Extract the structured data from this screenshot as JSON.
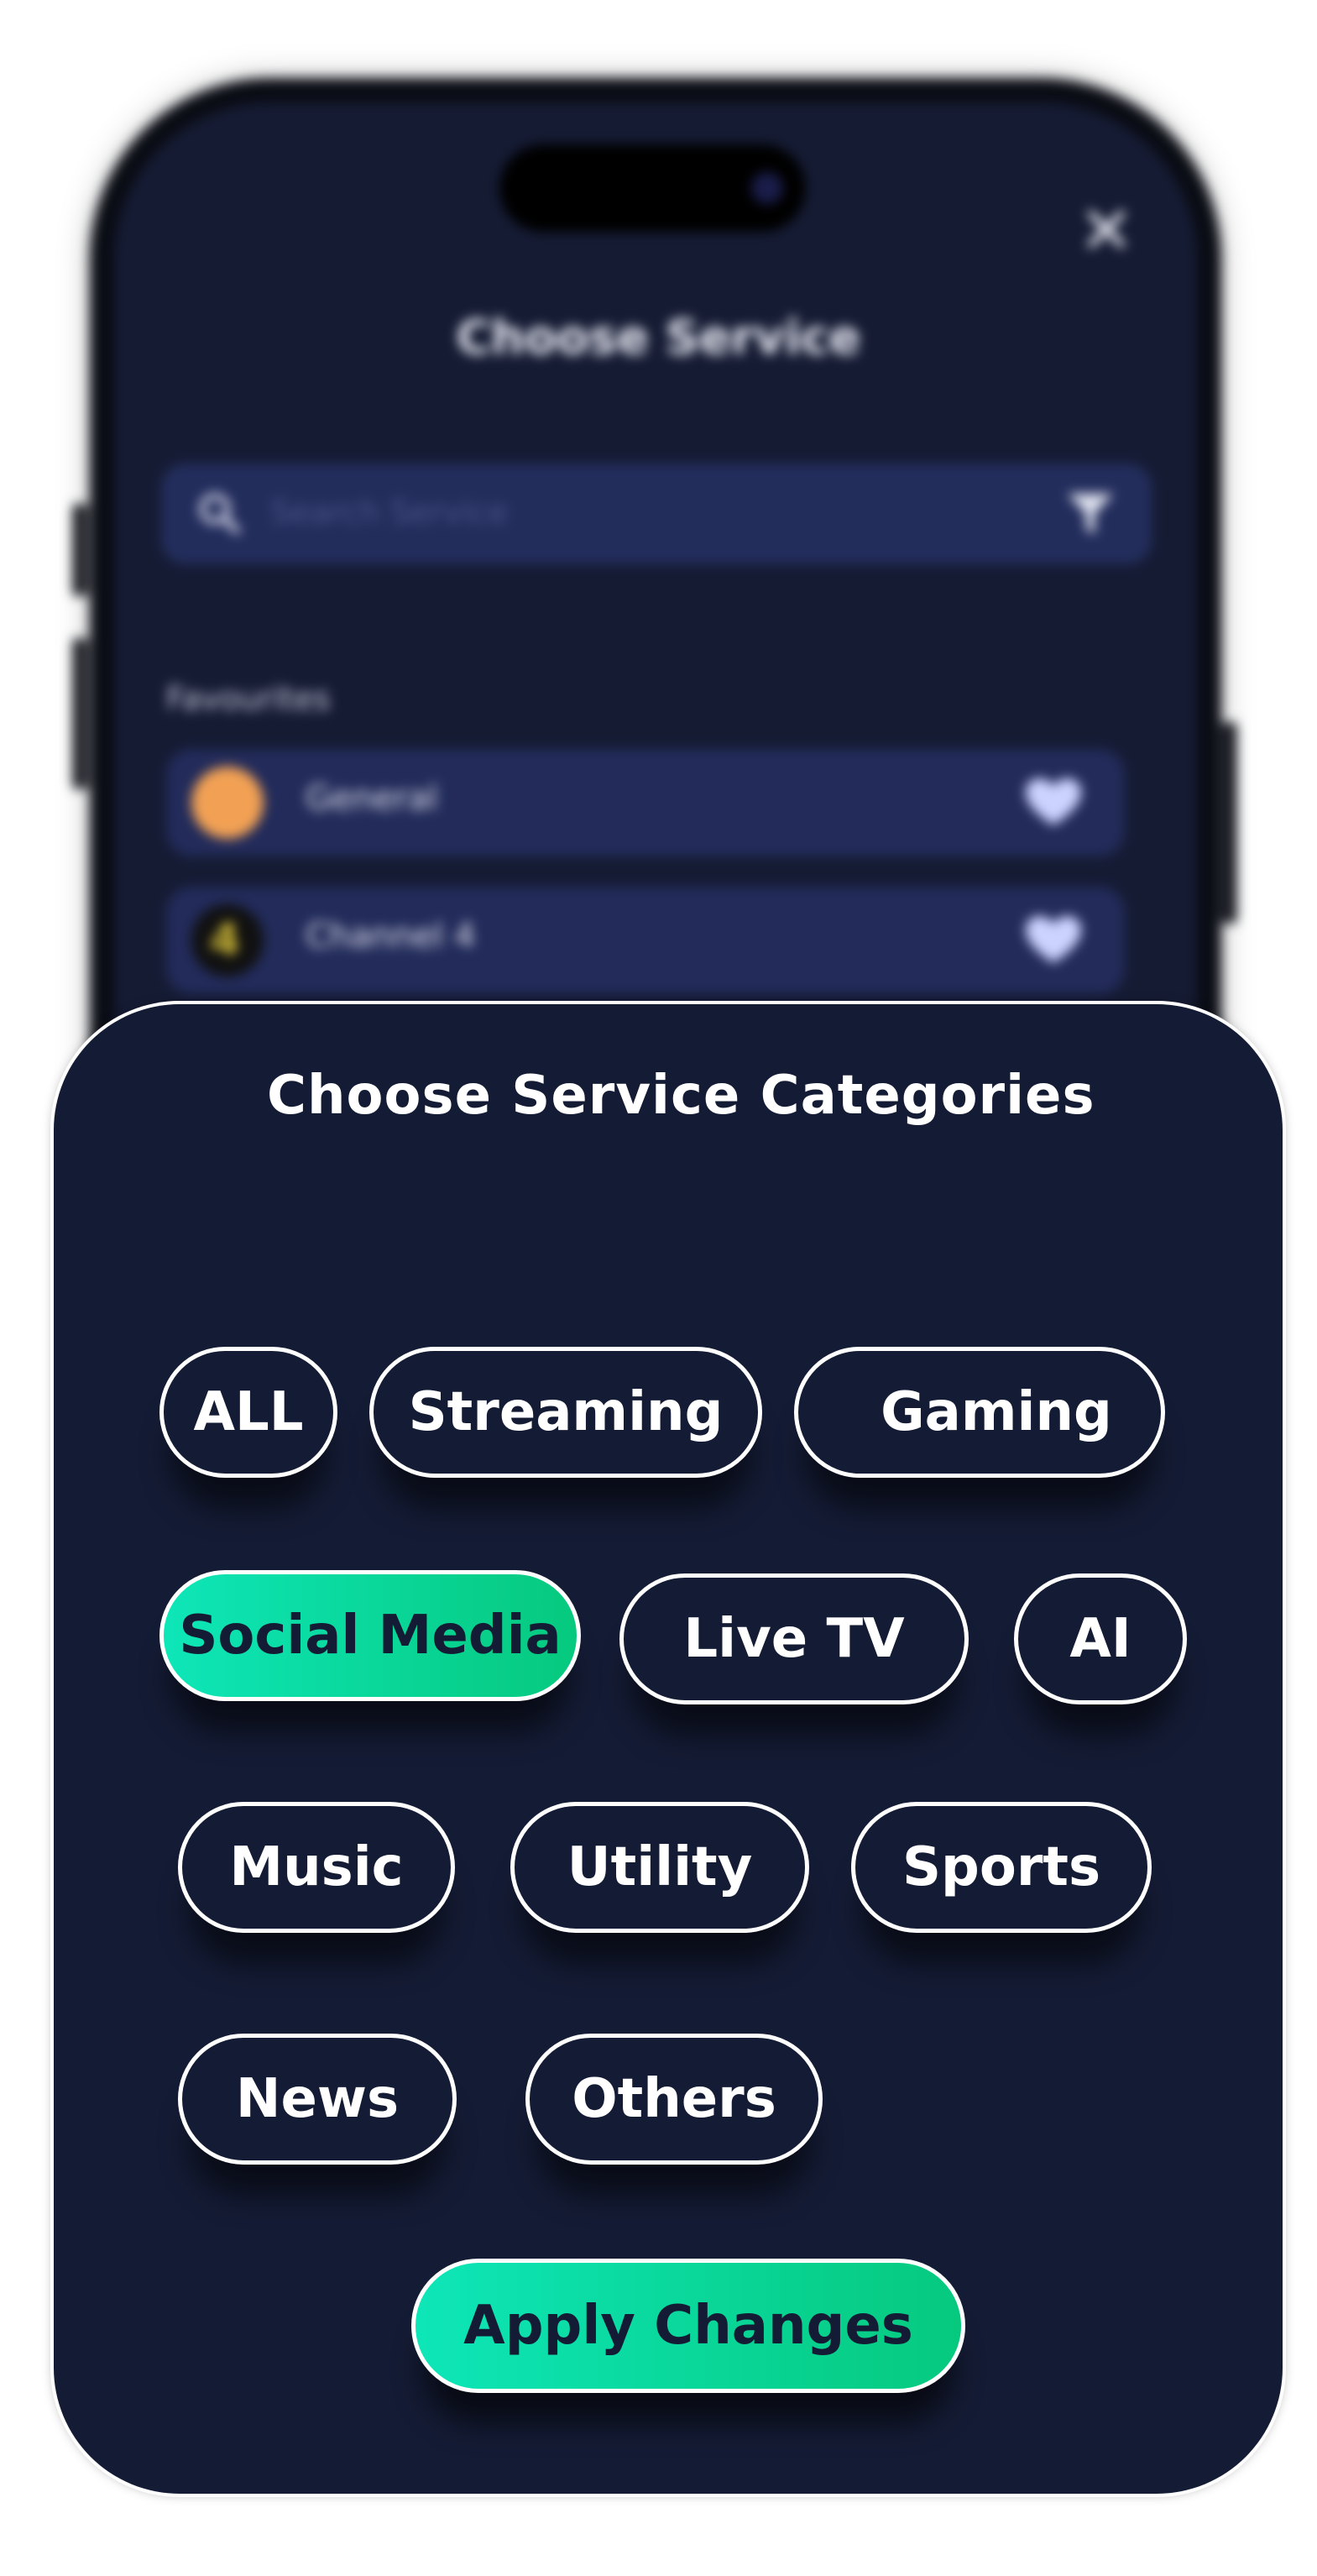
{
  "background_screen": {
    "title": "Choose Service",
    "search_placeholder": "Search Service",
    "section_label": "Favourites",
    "items": [
      {
        "label": "General",
        "logo": "compass-icon",
        "color": "#f2a154"
      },
      {
        "label": "Channel 4",
        "logo": "channel4-logo",
        "color": "#d8c23a"
      }
    ],
    "icons": {
      "close": "close-icon",
      "search": "search-icon",
      "filter": "filter-icon",
      "favourite": "heart-icon"
    }
  },
  "sheet": {
    "title": "Choose Service Categories",
    "categories": [
      {
        "label": "ALL",
        "selected": false
      },
      {
        "label": "Streaming",
        "selected": false
      },
      {
        "label": "Gaming",
        "selected": false
      },
      {
        "label": "Social Media",
        "selected": true
      },
      {
        "label": "Live TV",
        "selected": false
      },
      {
        "label": "AI",
        "selected": false
      },
      {
        "label": "Music",
        "selected": false
      },
      {
        "label": "Utility",
        "selected": false
      },
      {
        "label": "Sports",
        "selected": false
      },
      {
        "label": "News",
        "selected": false
      },
      {
        "label": "Others",
        "selected": false
      }
    ],
    "apply_label": "Apply Changes"
  },
  "colors": {
    "sheet_background": "#141b34",
    "accent_start": "#0ee6b8",
    "accent_end": "#06c97e",
    "chip_border": "#ffffff"
  }
}
